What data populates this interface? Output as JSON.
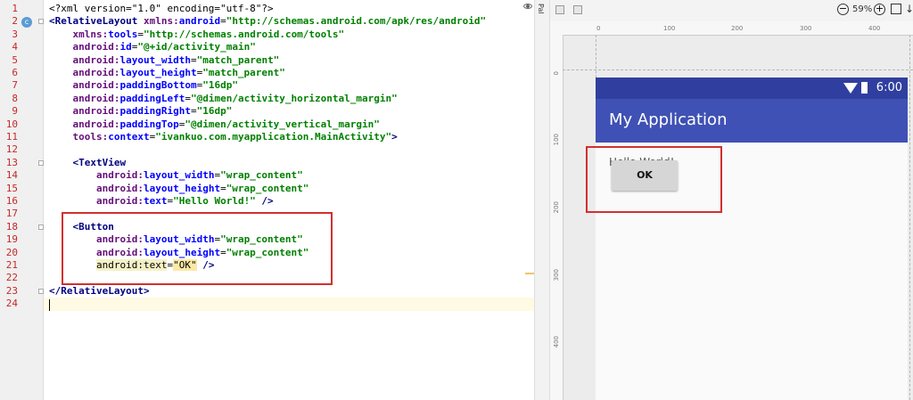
{
  "editor": {
    "line_numbers": [
      "1",
      "2",
      "3",
      "4",
      "5",
      "6",
      "7",
      "8",
      "9",
      "10",
      "11",
      "12",
      "13",
      "14",
      "15",
      "16",
      "17",
      "18",
      "19",
      "20",
      "21",
      "22",
      "23",
      "24"
    ],
    "gutter_marker": "c",
    "lines": [
      {
        "parts": [
          {
            "t": "pi",
            "v": "<?xml version=\"1.0\" encoding=\"utf-8\"?>"
          }
        ]
      },
      {
        "parts": [
          {
            "t": "tag",
            "v": "<RelativeLayout "
          },
          {
            "t": "ns",
            "v": "xmlns:"
          },
          {
            "t": "attr",
            "v": "android"
          },
          {
            "t": "pi",
            "v": "="
          },
          {
            "t": "val",
            "v": "\"http://schemas.android.com/apk/res/android\""
          }
        ]
      },
      {
        "parts": [
          {
            "t": "pi",
            "v": "    "
          },
          {
            "t": "ns",
            "v": "xmlns:"
          },
          {
            "t": "attr",
            "v": "tools"
          },
          {
            "t": "pi",
            "v": "="
          },
          {
            "t": "val",
            "v": "\"http://schemas.android.com/tools\""
          }
        ]
      },
      {
        "parts": [
          {
            "t": "pi",
            "v": "    "
          },
          {
            "t": "ns",
            "v": "android:"
          },
          {
            "t": "attr",
            "v": "id"
          },
          {
            "t": "pi",
            "v": "="
          },
          {
            "t": "val",
            "v": "\"@+id/activity_main\""
          }
        ]
      },
      {
        "parts": [
          {
            "t": "pi",
            "v": "    "
          },
          {
            "t": "ns",
            "v": "android:"
          },
          {
            "t": "attr",
            "v": "layout_width"
          },
          {
            "t": "pi",
            "v": "="
          },
          {
            "t": "val",
            "v": "\"match_parent\""
          }
        ]
      },
      {
        "parts": [
          {
            "t": "pi",
            "v": "    "
          },
          {
            "t": "ns",
            "v": "android:"
          },
          {
            "t": "attr",
            "v": "layout_height"
          },
          {
            "t": "pi",
            "v": "="
          },
          {
            "t": "val",
            "v": "\"match_parent\""
          }
        ]
      },
      {
        "parts": [
          {
            "t": "pi",
            "v": "    "
          },
          {
            "t": "ns",
            "v": "android:"
          },
          {
            "t": "attr",
            "v": "paddingBottom"
          },
          {
            "t": "pi",
            "v": "="
          },
          {
            "t": "val",
            "v": "\"16dp\""
          }
        ]
      },
      {
        "parts": [
          {
            "t": "pi",
            "v": "    "
          },
          {
            "t": "ns",
            "v": "android:"
          },
          {
            "t": "attr",
            "v": "paddingLeft"
          },
          {
            "t": "pi",
            "v": "="
          },
          {
            "t": "val",
            "v": "\"@dimen/activity_horizontal_margin\""
          }
        ]
      },
      {
        "parts": [
          {
            "t": "pi",
            "v": "    "
          },
          {
            "t": "ns",
            "v": "android:"
          },
          {
            "t": "attr",
            "v": "paddingRight"
          },
          {
            "t": "pi",
            "v": "="
          },
          {
            "t": "val",
            "v": "\"16dp\""
          }
        ]
      },
      {
        "parts": [
          {
            "t": "pi",
            "v": "    "
          },
          {
            "t": "ns",
            "v": "android:"
          },
          {
            "t": "attr",
            "v": "paddingTop"
          },
          {
            "t": "pi",
            "v": "="
          },
          {
            "t": "val",
            "v": "\"@dimen/activity_vertical_margin\""
          }
        ]
      },
      {
        "parts": [
          {
            "t": "pi",
            "v": "    "
          },
          {
            "t": "ns",
            "v": "tools:"
          },
          {
            "t": "attr",
            "v": "context"
          },
          {
            "t": "pi",
            "v": "="
          },
          {
            "t": "val",
            "v": "\"ivankuo.com.myapplication.MainActivity\""
          },
          {
            "t": "tag",
            "v": ">"
          }
        ]
      },
      {
        "parts": []
      },
      {
        "parts": [
          {
            "t": "pi",
            "v": "    "
          },
          {
            "t": "tag",
            "v": "<TextView"
          }
        ]
      },
      {
        "parts": [
          {
            "t": "pi",
            "v": "        "
          },
          {
            "t": "ns",
            "v": "android:"
          },
          {
            "t": "attr",
            "v": "layout_width"
          },
          {
            "t": "pi",
            "v": "="
          },
          {
            "t": "val",
            "v": "\"wrap_content\""
          }
        ]
      },
      {
        "parts": [
          {
            "t": "pi",
            "v": "        "
          },
          {
            "t": "ns",
            "v": "android:"
          },
          {
            "t": "attr",
            "v": "layout_height"
          },
          {
            "t": "pi",
            "v": "="
          },
          {
            "t": "val",
            "v": "\"wrap_content\""
          }
        ]
      },
      {
        "parts": [
          {
            "t": "pi",
            "v": "        "
          },
          {
            "t": "ns",
            "v": "android:"
          },
          {
            "t": "attr",
            "v": "text"
          },
          {
            "t": "pi",
            "v": "="
          },
          {
            "t": "val",
            "v": "\"Hello World!\""
          },
          {
            "t": "tag",
            "v": " />"
          }
        ]
      },
      {
        "parts": []
      },
      {
        "parts": [
          {
            "t": "pi",
            "v": "    "
          },
          {
            "t": "tag",
            "v": "<Button"
          }
        ]
      },
      {
        "parts": [
          {
            "t": "pi",
            "v": "        "
          },
          {
            "t": "ns",
            "v": "android:"
          },
          {
            "t": "attr",
            "v": "layout_width"
          },
          {
            "t": "pi",
            "v": "="
          },
          {
            "t": "val",
            "v": "\"wrap_content\""
          }
        ]
      },
      {
        "parts": [
          {
            "t": "pi",
            "v": "        "
          },
          {
            "t": "ns",
            "v": "android:"
          },
          {
            "t": "attr",
            "v": "layout_height"
          },
          {
            "t": "pi",
            "v": "="
          },
          {
            "t": "val",
            "v": "\"wrap_content\""
          }
        ]
      },
      {
        "parts": [
          {
            "t": "pi",
            "v": "        "
          },
          {
            "t": "hl",
            "v": "android:text"
          },
          {
            "t": "pi",
            "v": "="
          },
          {
            "t": "warn",
            "v": "\"OK\""
          },
          {
            "t": "tag",
            "v": " />"
          }
        ]
      },
      {
        "parts": []
      },
      {
        "parts": [
          {
            "t": "tag",
            "v": "</RelativeLayout>"
          }
        ]
      },
      {
        "parts": []
      }
    ]
  },
  "designer": {
    "palette_label": "Pal",
    "zoom": "59%",
    "ruler_top": [
      "0",
      "100",
      "200",
      "300",
      "400"
    ],
    "ruler_left": [
      "0",
      "100",
      "200",
      "300",
      "400"
    ],
    "device": {
      "status_time": "6:00",
      "app_title": "My Application",
      "textview_text": "Hello World!",
      "button_text": "OK"
    }
  },
  "colors": {
    "annotation": "#d32f2f",
    "status_bar": "#303f9f",
    "app_bar": "#3f51b5"
  }
}
